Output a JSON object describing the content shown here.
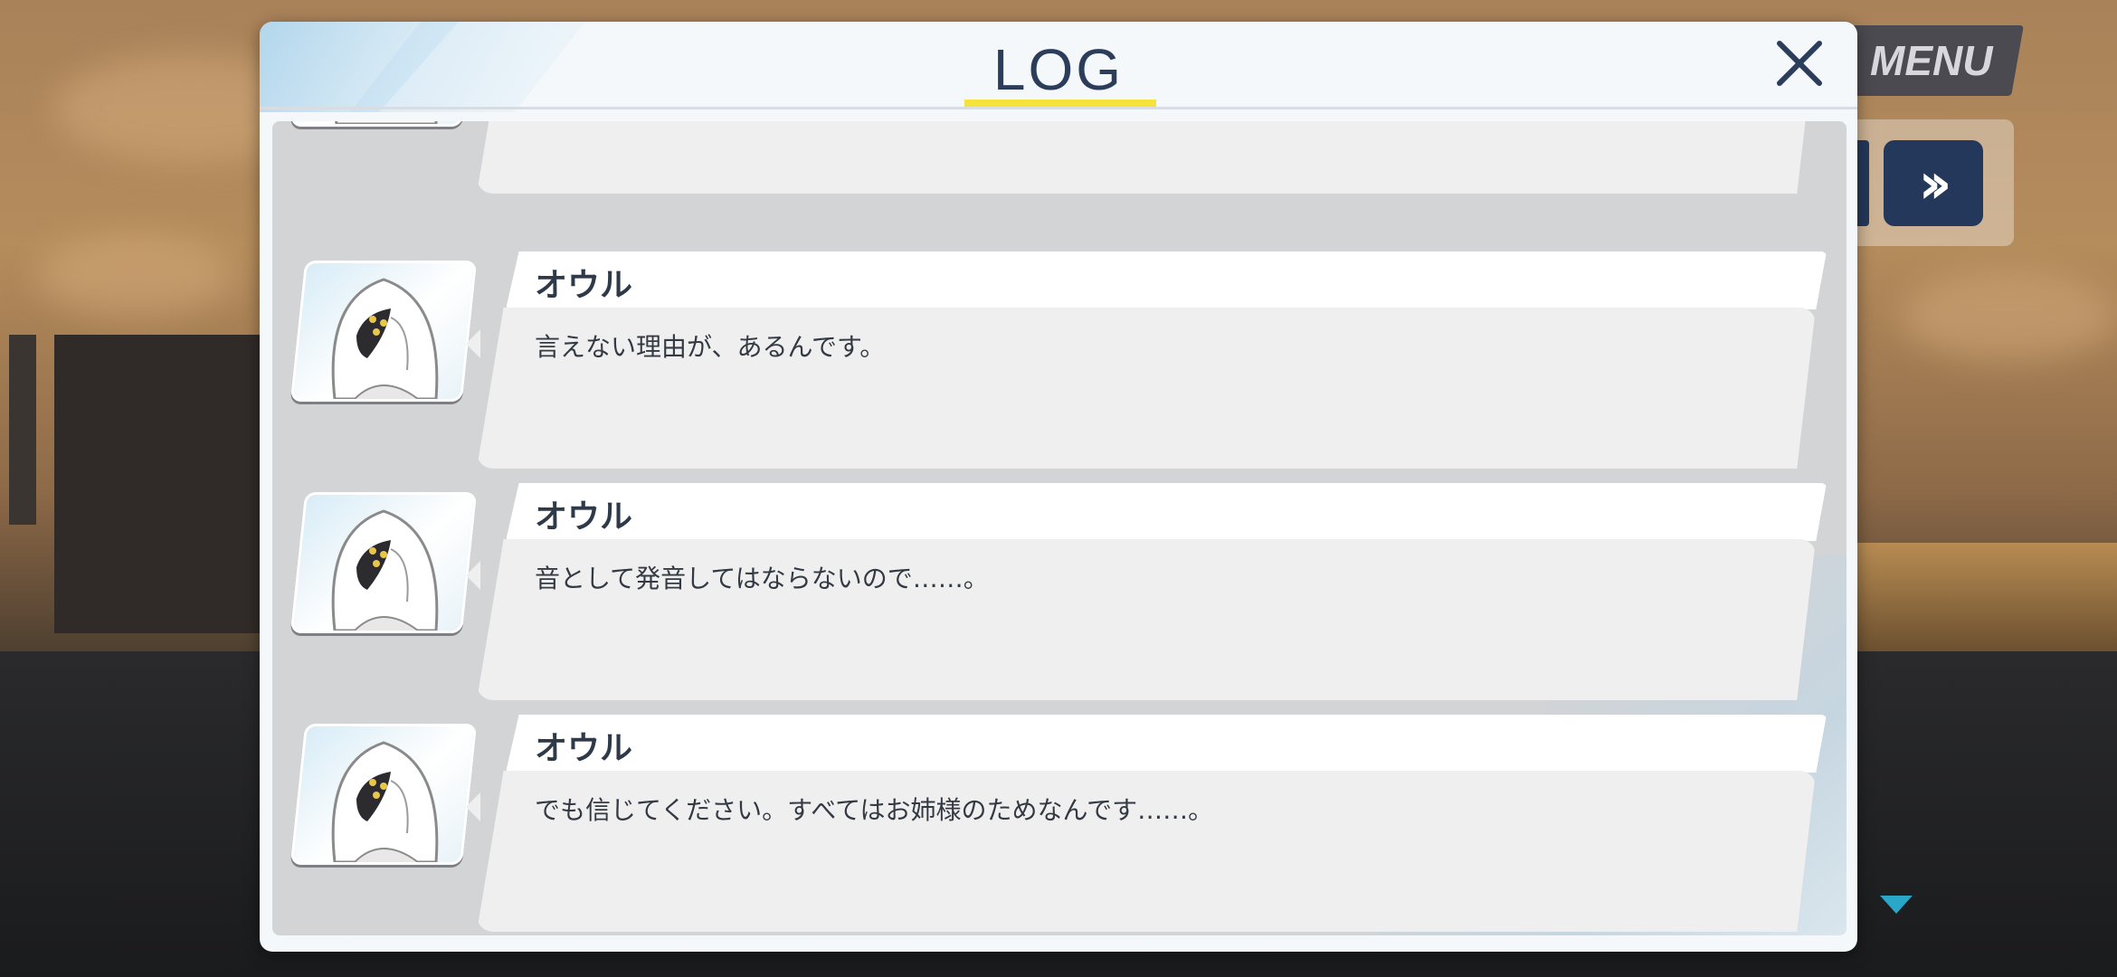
{
  "window": {
    "title": "LOG",
    "close_label": "close"
  },
  "background_controls": {
    "menu_label": "MENU",
    "fast_forward_label": "»",
    "scroll_indicator": "scroll-down-indicator"
  },
  "log": {
    "entries": [
      {
        "speaker": "",
        "text": ""
      },
      {
        "speaker": "オウル",
        "text": "言えない理由が、あるんです。"
      },
      {
        "speaker": "オウル",
        "text": "音として発音してはならないので……。"
      },
      {
        "speaker": "オウル",
        "text": "でも信じてください。すべてはお姉様のためなんです……。"
      }
    ]
  },
  "colors": {
    "title_text": "#2b3d5a",
    "title_underline": "#f5e23a",
    "speaker_text": "#2f3a48",
    "panel": "#d3d4d5",
    "button_navy": "#23385a"
  },
  "icons": [
    "close-icon",
    "fast-forward-icon",
    "triangle-down-icon",
    "character-portrait"
  ]
}
